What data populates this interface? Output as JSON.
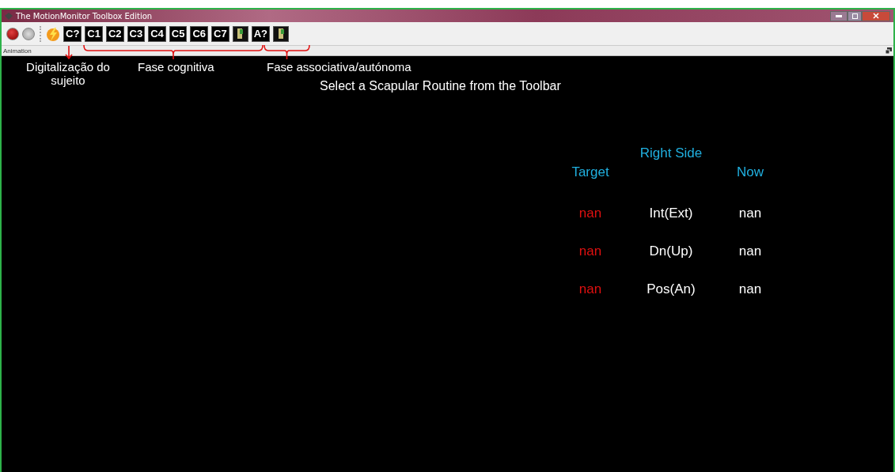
{
  "window": {
    "title": "The MotionMonitor Toolbox Edition"
  },
  "toolbar": [
    {
      "kind": "record"
    },
    {
      "kind": "stop"
    },
    {
      "kind": "separator"
    },
    {
      "kind": "bolt"
    },
    {
      "kind": "label",
      "label": "C?"
    },
    {
      "kind": "label",
      "label": "C1"
    },
    {
      "kind": "label",
      "label": "C2"
    },
    {
      "kind": "label",
      "label": "C3"
    },
    {
      "kind": "label",
      "label": "C4"
    },
    {
      "kind": "label",
      "label": "C5"
    },
    {
      "kind": "label",
      "label": "C6"
    },
    {
      "kind": "label",
      "label": "C7"
    },
    {
      "kind": "image"
    },
    {
      "kind": "label",
      "label": "A?"
    },
    {
      "kind": "image"
    }
  ],
  "panel_title": "Animation",
  "annotations": [
    {
      "kind": "arrow",
      "label": "Digitalização do sujeito"
    },
    {
      "kind": "bracket",
      "label": "Fase cognitiva"
    },
    {
      "kind": "bracket",
      "label": "Fase associativa/autónoma"
    }
  ],
  "message": "Select a Scapular Routine from the Toolbar",
  "readout": {
    "title": "Right Side",
    "columns": [
      "Target",
      "Now"
    ],
    "rows": [
      {
        "target": "nan",
        "name": "Int(Ext)",
        "now": "nan"
      },
      {
        "target": "nan",
        "name": "Dn(Up)",
        "now": "nan"
      },
      {
        "target": "nan",
        "name": "Pos(An)",
        "now": "nan"
      }
    ]
  }
}
